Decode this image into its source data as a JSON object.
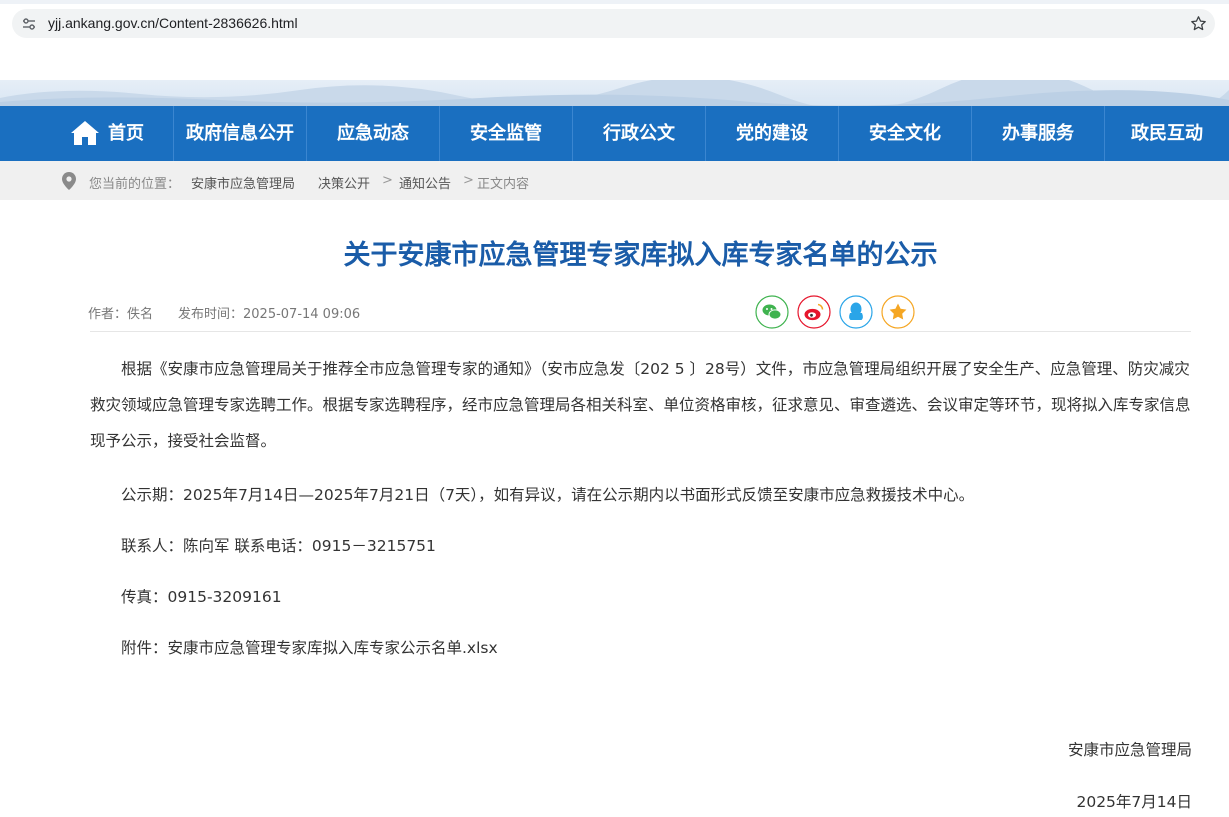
{
  "browser": {
    "url": "yjj.ankang.gov.cn/Content-2836626.html",
    "site_icon": "site-settings-icon",
    "bookmark_icon": "star-icon"
  },
  "nav": {
    "items": [
      {
        "label": "首页",
        "icon": "home-icon"
      },
      {
        "label": "政府信息公开"
      },
      {
        "label": "应急动态"
      },
      {
        "label": "安全监管"
      },
      {
        "label": "行政公文"
      },
      {
        "label": "党的建设"
      },
      {
        "label": "安全文化"
      },
      {
        "label": "办事服务"
      },
      {
        "label": "政民互动"
      }
    ],
    "background": "#1a6fc0"
  },
  "breadcrumb": {
    "prefix": "您当前的位置：",
    "items": [
      "安康市应急管理局",
      "决策公开",
      "通知公告",
      "正文内容"
    ],
    "separator": ">"
  },
  "article": {
    "title": "关于安康市应急管理专家库拟入库专家名单的公示",
    "author": "作者：佚名",
    "published": "发布时间：2025-07-14 09:06",
    "share_icons": [
      "wechat-icon",
      "weibo-icon",
      "qq-icon",
      "favorite-icon"
    ],
    "paragraph1": "根据《安康市应急管理局关于推荐全市应急管理专家的通知》（安市应急发〔202 5 〕28号）文件，市应急管理局组织开展了安全生产、应急管理、防灾减灾救灾领域应急管理专家选聘工作。根据专家选聘程序，经市应急管理局各相关科室、单位资格审核，征求意见、审查遴选、会议审定等环节，现将拟入库专家信息现予公示，接受社会监督。",
    "period": "公示期：2025年7月14日—2025年7月21日（7天），如有异议，请在公示期内以书面形式反馈至安康市应急救援技术中心。",
    "contact": "联系人：陈向军   联系电话：0915－3215751",
    "fax": "传真：0915-3209161",
    "attachment": "附件：安康市应急管理专家库拟入库专家公示名单.xlsx",
    "signature": "安康市应急管理局",
    "date": "2025年7月14日"
  },
  "colors": {
    "title": "#1a5ca8",
    "wechat": "#3fb34f",
    "weibo": "#e6162d",
    "qq": "#2aa5e8",
    "favorite": "#f5a623"
  }
}
